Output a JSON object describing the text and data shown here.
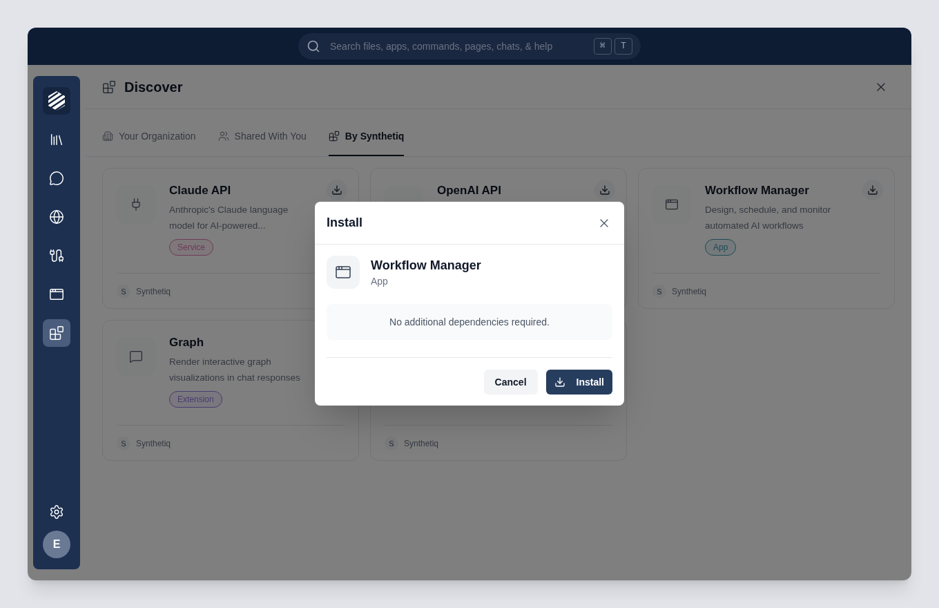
{
  "search": {
    "placeholder": "Search files, apps, commands, pages, chats, & help",
    "keys": [
      "⌘",
      "T"
    ]
  },
  "sidebar": {
    "items": [
      {
        "kind": "library",
        "selected": false
      },
      {
        "kind": "chat",
        "selected": false
      },
      {
        "kind": "globe",
        "selected": false
      },
      {
        "kind": "cable",
        "selected": false
      },
      {
        "kind": "window",
        "selected": false
      },
      {
        "kind": "blocks",
        "selected": true
      }
    ],
    "avatar": "E"
  },
  "panel": {
    "title": "Discover",
    "tabs": [
      {
        "label": "Your Organization",
        "kind": "building",
        "selected": false
      },
      {
        "label": "Shared With You",
        "kind": "users",
        "selected": false
      },
      {
        "label": "By Synthetiq",
        "kind": "blocks",
        "selected": true
      }
    ],
    "cards": [
      {
        "kind": "plug",
        "download": true,
        "title": "Claude API",
        "description": "Anthropic's Claude language model for AI-powered...",
        "tag": {
          "label": "Service",
          "color": "#6e3a55"
        },
        "author_initial": "S",
        "author": "Synthetiq"
      },
      {
        "kind": "none",
        "download": true,
        "title": "OpenAI API"
      },
      {
        "kind": "window",
        "download": true,
        "title": "Workflow Manager",
        "description": "Design, schedule, and monitor automated AI workflows",
        "tag": {
          "label": "App",
          "color": "#1f4a55"
        },
        "author_initial": "S",
        "author": "Synthetiq"
      },
      {
        "kind": "chat",
        "title": "Graph",
        "description": "Render interactive graph visualizations in chat responses",
        "tag": {
          "label": "Extension",
          "color": "#4a3a70"
        },
        "author_initial": "S",
        "author": "Synthetiq"
      },
      {
        "kind": "none",
        "author_initial": "S",
        "author": "Synthetiq"
      }
    ]
  },
  "dialog": {
    "title": "Install",
    "item": {
      "kind": "window",
      "name": "Workflow Manager",
      "type": "App"
    },
    "message": "No additional dependencies required.",
    "buttons": [
      {
        "label": "Cancel",
        "kind": "secondary"
      },
      {
        "label": "Install",
        "kind": "primary"
      }
    ]
  }
}
